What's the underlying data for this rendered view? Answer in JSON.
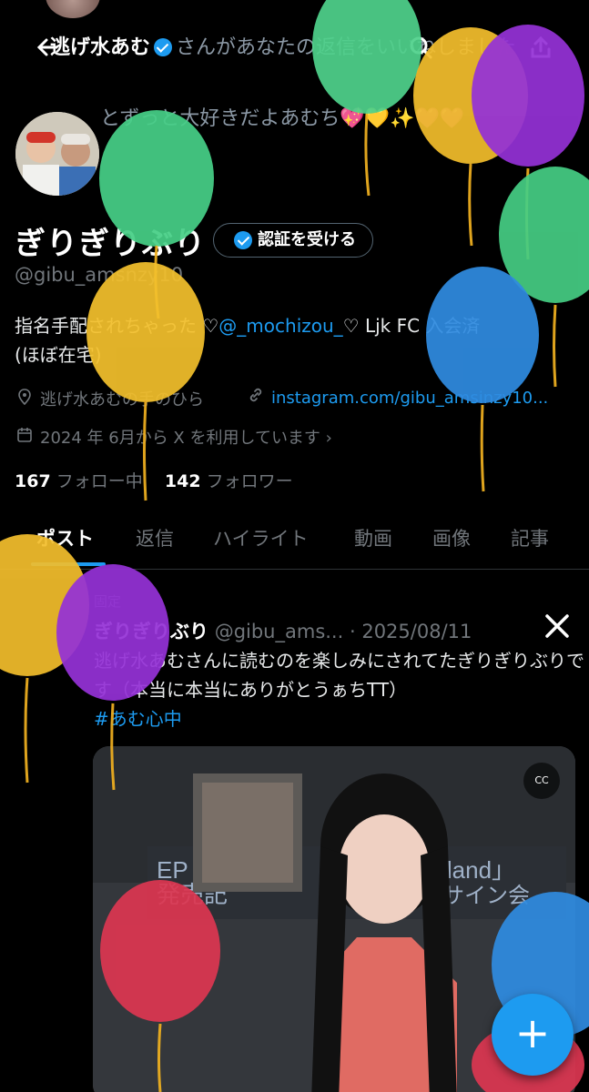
{
  "reply_banner": {
    "name": "逃げ水あむ",
    "text": "さんがあなたの返信をいいねしました",
    "sub": "とずっと大好きだよあむち💖💛✨💜💜"
  },
  "profile": {
    "display_name": "ぎりぎりぶり",
    "verify_button": "認証を受ける",
    "handle": "@gibu_amsnzy10",
    "bio_prefix": "指名手配されちゃった ♡",
    "bio_mention": "@_mochizou_",
    "bio_suffix": "♡ Ljk FC 入会済",
    "bio_line2": "(ほぼ在宅)",
    "location": "逃げ水あむの手のひら",
    "link": "instagram.com/gibu_amsinzy10...",
    "joined": "2024 年 6月から X を利用しています ›",
    "following_count": "167",
    "following_label": "フォロー中",
    "followers_count": "142",
    "followers_label": "フォロワー"
  },
  "tabs": [
    {
      "label": "ポスト"
    },
    {
      "label": "返信"
    },
    {
      "label": "ハイライト"
    },
    {
      "label": "動画"
    },
    {
      "label": "画像"
    },
    {
      "label": "記事"
    }
  ],
  "post": {
    "pinned_label": "固定",
    "author": "ぎりぎりぶり",
    "handle": "@gibu_ams...",
    "date": "· 2025/08/11",
    "text": "逃げ水あむさんに読むのを楽しみにされてたぎりぎりぶりです（本当に本当にありがとうぁちTT）",
    "hashtag": "#あむ心中",
    "media_caption_left": "EP",
    "media_caption_right": "lerland」",
    "media_caption_bottom": "発売記",
    "media_caption_bottom2": "トサイン会",
    "cc_label": "CC"
  },
  "fab_label": "+",
  "colors": {
    "accent": "#1d9bf0",
    "background": "#000000",
    "muted": "#71767b"
  },
  "icons": [
    "back-arrow-icon",
    "search-icon",
    "share-icon",
    "verified-badge-icon",
    "location-icon",
    "link-icon",
    "calendar-icon",
    "x-logo-icon",
    "closed-caption-icon",
    "plus-icon",
    "balloon-decoration"
  ]
}
